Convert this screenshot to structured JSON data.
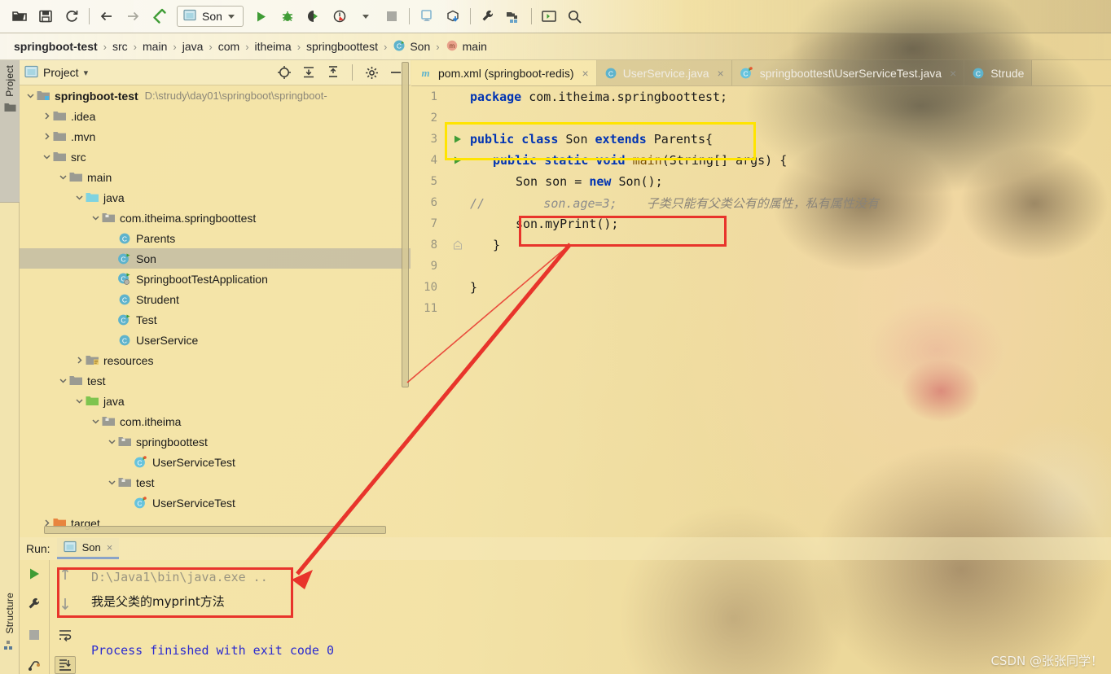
{
  "colors": {
    "accent_green": "#3f9c35",
    "highlight_yellow": "#ffe400",
    "highlight_red": "#e8342b",
    "keyword_blue": "#0033b3",
    "console_blue": "#2b2bd0",
    "background_tan": "#f4e4a8"
  },
  "toolbar": {
    "icons": [
      {
        "name": "open-folder-icon"
      },
      {
        "name": "save-all-icon"
      },
      {
        "name": "sync-refresh-icon"
      },
      {
        "name": "back-arrow-icon"
      },
      {
        "name": "forward-arrow-icon"
      },
      {
        "name": "build-hammer-icon"
      }
    ],
    "run_config": {
      "label": "Son",
      "icon": "run-config-icon"
    },
    "run_icons": [
      {
        "name": "run-icon"
      },
      {
        "name": "debug-bug-icon"
      },
      {
        "name": "run-with-coverage-icon"
      },
      {
        "name": "profiler-icon"
      },
      {
        "name": "dropdown-caret-icon"
      },
      {
        "name": "stop-icon"
      }
    ],
    "right_icons": [
      {
        "name": "update-project-icon"
      },
      {
        "name": "download-package-icon"
      },
      {
        "name": "settings-wrench-icon"
      },
      {
        "name": "project-structure-icon"
      },
      {
        "name": "terminal-icon"
      },
      {
        "name": "search-icon"
      }
    ]
  },
  "breadcrumb": {
    "items": [
      {
        "label": "springboot-test",
        "bold": true,
        "icon": ""
      },
      {
        "label": "src",
        "bold": false,
        "icon": ""
      },
      {
        "label": "main",
        "bold": false,
        "icon": ""
      },
      {
        "label": "java",
        "bold": false,
        "icon": ""
      },
      {
        "label": "com",
        "bold": false,
        "icon": ""
      },
      {
        "label": "itheima",
        "bold": false,
        "icon": ""
      },
      {
        "label": "springboottest",
        "bold": false,
        "icon": ""
      },
      {
        "label": "Son",
        "bold": false,
        "icon": "class-icon"
      },
      {
        "label": "main",
        "bold": false,
        "icon": "method-icon"
      }
    ],
    "separator": "›"
  },
  "left_strip": {
    "project_label": "Project",
    "project_icon": "project-folder-icon",
    "structure_label": "Structure",
    "structure_icon": "structure-icon"
  },
  "project_panel": {
    "title": "Project",
    "title_caret": "▾",
    "header_icons": [
      {
        "name": "locate-target-icon"
      },
      {
        "name": "expand-all-icon"
      },
      {
        "name": "collapse-all-icon"
      },
      {
        "name": "gear-icon"
      },
      {
        "name": "hide-minimize-icon"
      }
    ],
    "tree": [
      {
        "depth": 0,
        "arrow": "down",
        "icon": "module-folder-icon",
        "label": "springboot-test",
        "bold": true,
        "path": "D:\\strudy\\day01\\springboot\\springboot-",
        "selected": false
      },
      {
        "depth": 1,
        "arrow": "right",
        "icon": "folder-icon",
        "label": ".idea",
        "bold": false,
        "path": "",
        "selected": false
      },
      {
        "depth": 1,
        "arrow": "right",
        "icon": "folder-icon",
        "label": ".mvn",
        "bold": false,
        "path": "",
        "selected": false
      },
      {
        "depth": 1,
        "arrow": "down",
        "icon": "folder-icon",
        "label": "src",
        "bold": false,
        "path": "",
        "selected": false
      },
      {
        "depth": 2,
        "arrow": "down",
        "icon": "folder-icon",
        "label": "main",
        "bold": false,
        "path": "",
        "selected": false
      },
      {
        "depth": 3,
        "arrow": "down",
        "icon": "source-folder-icon",
        "label": "java",
        "bold": false,
        "path": "",
        "selected": false
      },
      {
        "depth": 4,
        "arrow": "down",
        "icon": "package-icon",
        "label": "com.itheima.springboottest",
        "bold": false,
        "path": "",
        "selected": false
      },
      {
        "depth": 5,
        "arrow": "none",
        "icon": "class-icon",
        "label": "Parents",
        "bold": false,
        "path": "",
        "selected": false
      },
      {
        "depth": 5,
        "arrow": "none",
        "icon": "runnable-class-icon",
        "label": "Son",
        "bold": false,
        "path": "",
        "selected": true
      },
      {
        "depth": 5,
        "arrow": "none",
        "icon": "spring-class-icon",
        "label": "SpringbootTestApplication",
        "bold": false,
        "path": "",
        "selected": false
      },
      {
        "depth": 5,
        "arrow": "none",
        "icon": "class-icon",
        "label": "Strudent",
        "bold": false,
        "path": "",
        "selected": false
      },
      {
        "depth": 5,
        "arrow": "none",
        "icon": "runnable-class-icon",
        "label": "Test",
        "bold": false,
        "path": "",
        "selected": false
      },
      {
        "depth": 5,
        "arrow": "none",
        "icon": "class-icon",
        "label": "UserService",
        "bold": false,
        "path": "",
        "selected": false
      },
      {
        "depth": 3,
        "arrow": "right",
        "icon": "resources-folder-icon",
        "label": "resources",
        "bold": false,
        "path": "",
        "selected": false
      },
      {
        "depth": 2,
        "arrow": "down",
        "icon": "folder-icon",
        "label": "test",
        "bold": false,
        "path": "",
        "selected": false
      },
      {
        "depth": 3,
        "arrow": "down",
        "icon": "test-source-folder-icon",
        "label": "java",
        "bold": false,
        "path": "",
        "selected": false
      },
      {
        "depth": 4,
        "arrow": "down",
        "icon": "package-icon",
        "label": "com.itheima",
        "bold": false,
        "path": "",
        "selected": false
      },
      {
        "depth": 5,
        "arrow": "down",
        "icon": "package-icon",
        "label": "springboottest",
        "bold": false,
        "path": "",
        "selected": false
      },
      {
        "depth": 6,
        "arrow": "none",
        "icon": "test-class-icon",
        "label": "UserServiceTest",
        "bold": false,
        "path": "",
        "selected": false
      },
      {
        "depth": 5,
        "arrow": "down",
        "icon": "package-icon",
        "label": "test",
        "bold": false,
        "path": "",
        "selected": false
      },
      {
        "depth": 6,
        "arrow": "none",
        "icon": "test-class-icon",
        "label": "UserServiceTest",
        "bold": false,
        "path": "",
        "selected": false
      },
      {
        "depth": 1,
        "arrow": "right",
        "icon": "target-folder-icon",
        "label": "target",
        "bold": false,
        "path": "",
        "selected": false
      }
    ]
  },
  "editor": {
    "tabs": [
      {
        "label": "pom.xml (springboot-redis)",
        "icon": "maven-icon",
        "active": true,
        "closable": true
      },
      {
        "label": "UserService.java",
        "icon": "class-icon",
        "active": false,
        "closable": true
      },
      {
        "label": "springboottest\\UserServiceTest.java",
        "icon": "test-class-icon",
        "active": false,
        "closable": true
      },
      {
        "label": "Strude",
        "icon": "class-icon",
        "active": false,
        "closable": false
      }
    ],
    "lines": [
      {
        "no": "1",
        "gutter": "",
        "segments": [
          {
            "t": "package ",
            "c": "k"
          },
          {
            "t": "com.itheima.springboottest;",
            "c": "plain"
          }
        ],
        "indent": 0
      },
      {
        "no": "2",
        "gutter": "",
        "segments": [],
        "indent": 0
      },
      {
        "no": "3",
        "gutter": "run",
        "segments": [
          {
            "t": "public class ",
            "c": "k"
          },
          {
            "t": "Son ",
            "c": "plain"
          },
          {
            "t": "extends ",
            "c": "k"
          },
          {
            "t": "Parents{",
            "c": "plain"
          }
        ],
        "indent": 0
      },
      {
        "no": "4",
        "gutter": "run",
        "segments": [
          {
            "t": "public static void ",
            "c": "k"
          },
          {
            "t": "main",
            "c": "fn"
          },
          {
            "t": "(String[] args) {",
            "c": "plain"
          }
        ],
        "indent": 1
      },
      {
        "no": "5",
        "gutter": "",
        "segments": [
          {
            "t": "Son son = ",
            "c": "plain"
          },
          {
            "t": "new ",
            "c": "k"
          },
          {
            "t": "Son();",
            "c": "plain"
          }
        ],
        "indent": 2
      },
      {
        "no": "6",
        "gutter": "",
        "segments": [
          {
            "t": "//        son.age=3;    ",
            "c": "cmt"
          },
          {
            "t": "子类只能有父类公有的属性，私有属性没有",
            "c": "cmt-zh"
          }
        ],
        "indent": 0
      },
      {
        "no": "7",
        "gutter": "",
        "segments": [
          {
            "t": "son.myPrint();",
            "c": "plain"
          }
        ],
        "indent": 2
      },
      {
        "no": "8",
        "gutter": "fold",
        "segments": [
          {
            "t": "}",
            "c": "plain"
          }
        ],
        "indent": 1
      },
      {
        "no": "9",
        "gutter": "",
        "segments": [],
        "indent": 0
      },
      {
        "no": "10",
        "gutter": "",
        "segments": [
          {
            "t": "}",
            "c": "plain"
          }
        ],
        "indent": 0
      },
      {
        "no": "11",
        "gutter": "",
        "segments": [],
        "indent": 0
      }
    ]
  },
  "run_panel": {
    "run_label": "Run:",
    "tab_label": "Son",
    "tab_icon": "run-config-icon",
    "tab_close": "×",
    "toolbar_a": [
      {
        "name": "rerun-icon"
      },
      {
        "name": "wrench-settings-icon"
      },
      {
        "name": "stop-icon"
      },
      {
        "name": "threads-icon"
      }
    ],
    "toolbar_b": [
      {
        "name": "up-arrow-icon"
      },
      {
        "name": "down-arrow-icon"
      },
      {
        "name": "soft-wrap-icon"
      },
      {
        "name": "scroll-to-end-icon"
      }
    ],
    "console": [
      {
        "text": "D:\\Java1\\bin\\java.exe ..",
        "style": "cmdline"
      },
      {
        "text": "我是父类的myprint方法",
        "style": "zh"
      },
      {
        "text": "",
        "style": "cmdline"
      },
      {
        "text": "Process finished with exit code 0",
        "style": "blue"
      }
    ]
  },
  "watermark": {
    "text": "CSDN @张张同学！"
  }
}
